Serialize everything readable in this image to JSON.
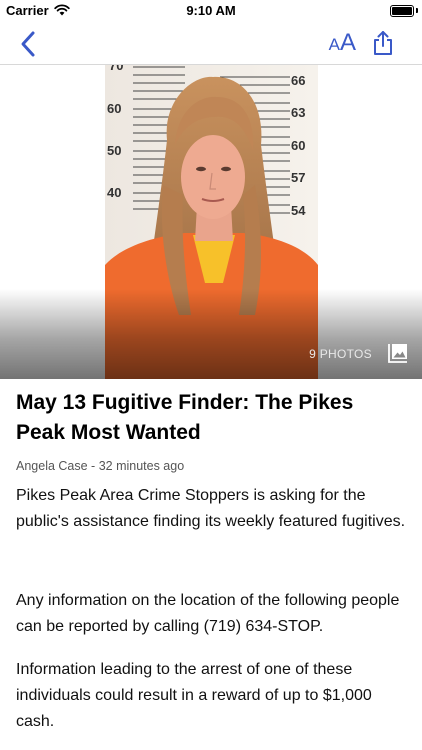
{
  "status_bar": {
    "carrier": "Carrier",
    "time": "9:10 AM"
  },
  "nav": {
    "font_small": "A",
    "font_large": "A",
    "accent_color": "#3a59c8"
  },
  "hero": {
    "photo_count": "9 PHOTOS",
    "height_chart_labels": [
      "70",
      "60",
      "50",
      "40",
      "66",
      "63",
      "60",
      "57",
      "54"
    ]
  },
  "article": {
    "headline": "May 13 Fugitive Finder: The Pikes Peak Most Wanted",
    "author": "Angela Case",
    "separator": " - ",
    "timestamp": "32 minutes ago",
    "paragraphs": [
      "Pikes Peak Area Crime Stoppers is asking for the public's assistance finding its weekly featured fugitives.",
      "Any information on the location of the following people can be reported by calling (719) 634-STOP.",
      "Information leading to the arrest of one of these individuals could result in a reward of up to $1,000 cash."
    ]
  }
}
